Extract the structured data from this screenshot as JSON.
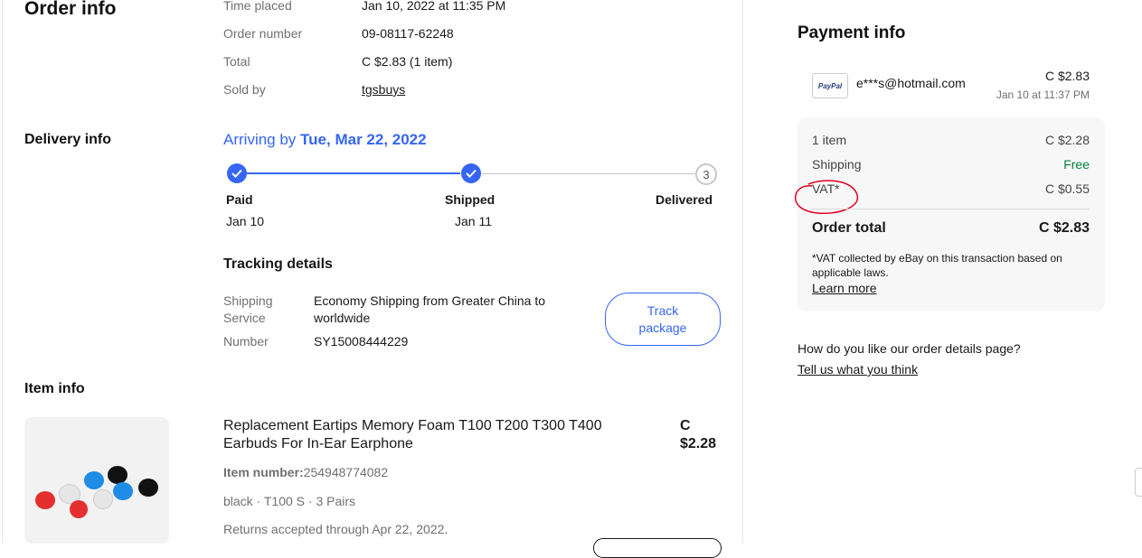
{
  "order": {
    "title": "Order info",
    "rows": [
      {
        "label": "Time placed",
        "value": "Jan 10, 2022 at 11:35 PM"
      },
      {
        "label": "Order number",
        "value": "09-08117-62248"
      },
      {
        "label": "Total",
        "value": "C $2.83 (1 item)"
      },
      {
        "label": "Sold by",
        "value": "tgsbuys"
      }
    ]
  },
  "delivery": {
    "title": "Delivery info",
    "arriving_prefix": "Arriving by",
    "arriving_date": "Tue, Mar 22, 2022",
    "steps": [
      {
        "label": "Paid",
        "date": "Jan 10"
      },
      {
        "label": "Shipped",
        "date": "Jan 11"
      },
      {
        "label": "Delivered",
        "number": "3"
      }
    ],
    "tracking_title": "Tracking details",
    "shipping_service_label_1": "Shipping",
    "shipping_service_label_2": "Service",
    "shipping_service_line_1": "Economy Shipping from Greater China to",
    "shipping_service_line_2": "worldwide",
    "number_label": "Number",
    "number_value": "SY15008444229",
    "track_line_1": "Track",
    "track_line_2": "package"
  },
  "item": {
    "title": "Item info",
    "name_line_1": "Replacement Eartips Memory Foam T100 T200 T300 T400",
    "name_line_2": "Earbuds For In-Ear Earphone",
    "price_line_1": "C",
    "price_line_2": "$2.28",
    "item_number_label": "Item number:",
    "item_number_value": "254948774082",
    "variant": "black · T100 S · 3 Pairs",
    "returns": "Returns accepted through Apr 22, 2022."
  },
  "payment": {
    "title": "Payment info",
    "method_logo": "PayPal",
    "email": "e***s@hotmail.com",
    "amount": "C $2.83",
    "paid_at": "Jan 10 at 11:37 PM",
    "lines": [
      {
        "label": "1 item",
        "value": "C $2.28"
      },
      {
        "label": "Shipping",
        "value": "Free"
      },
      {
        "label": "VAT*",
        "value": "C $0.55"
      }
    ],
    "total_label": "Order total",
    "total_value": "C $2.83",
    "vat_note_line_1": "*VAT collected by eBay on this transaction based on",
    "vat_note_line_2": "applicable laws.",
    "learn_more": "Learn more"
  },
  "feedback": {
    "question": "How do you like our order details page?",
    "link": "Tell us what you think"
  },
  "colors": {
    "accent": "#3665f3",
    "free": "#05823f",
    "annotation": "#e0001b"
  }
}
